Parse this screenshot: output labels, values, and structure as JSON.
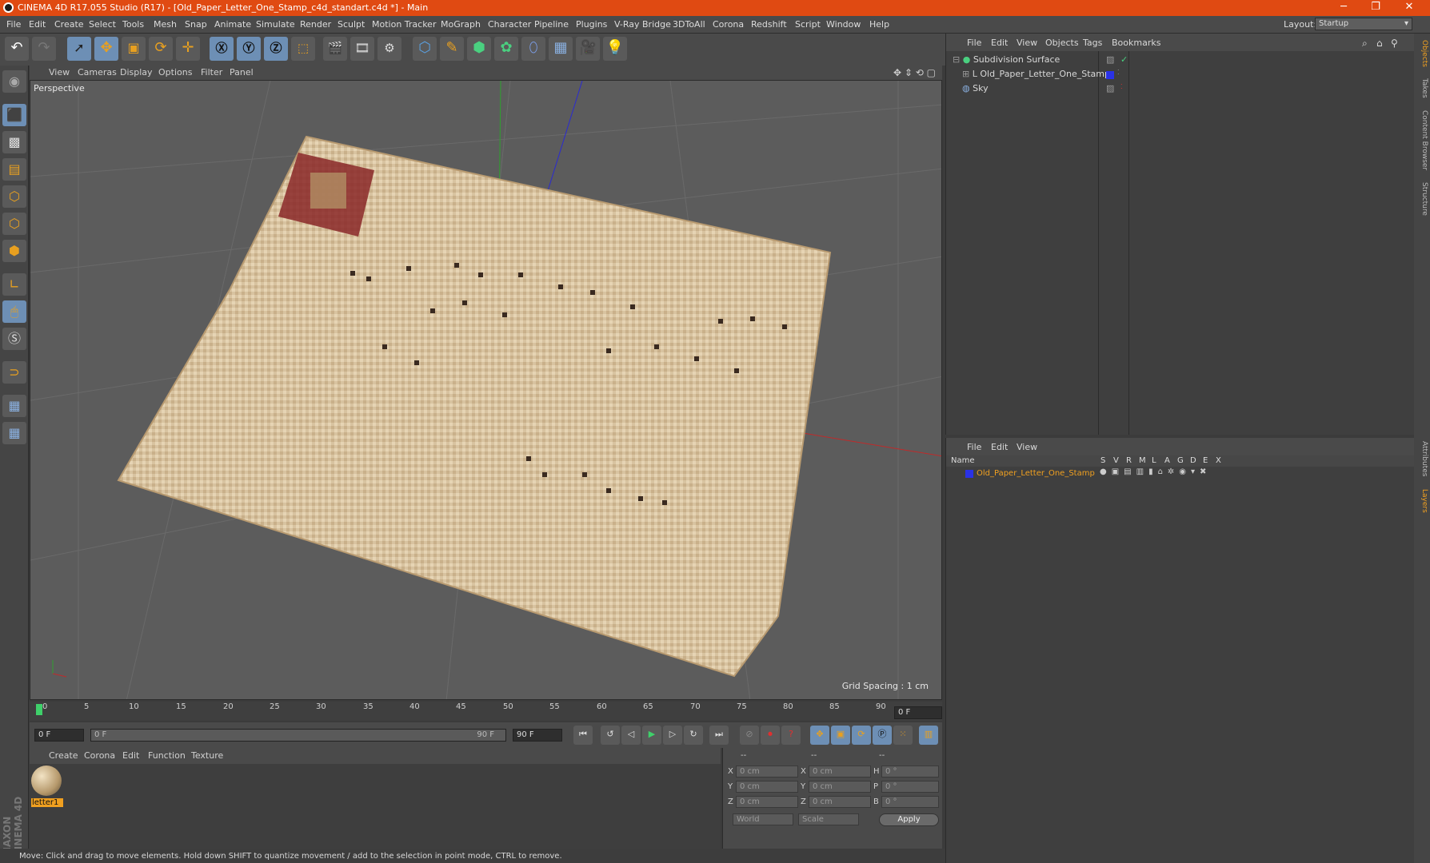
{
  "window": {
    "title": "CINEMA 4D R17.055 Studio (R17) - [Old_Paper_Letter_One_Stamp_c4d_standart.c4d *] - Main",
    "min": "─",
    "max": "❐",
    "close": "✕"
  },
  "menubar": [
    "File",
    "Edit",
    "Create",
    "Select",
    "Tools",
    "Mesh",
    "Snap",
    "Animate",
    "Simulate",
    "Render",
    "Sculpt",
    "Motion Tracker",
    "MoGraph",
    "Character",
    "Pipeline",
    "Plugins",
    "V-Ray Bridge",
    "3DToAll",
    "Corona",
    "Redshift",
    "Script",
    "Window",
    "Help"
  ],
  "layout": {
    "label": "Layout:",
    "value": "Startup"
  },
  "viewport": {
    "menu": [
      "View",
      "Cameras",
      "Display",
      "Options",
      "Filter",
      "Panel"
    ],
    "label": "Perspective",
    "grid_spacing": "Grid Spacing : 1 cm"
  },
  "timeline": {
    "ticks": [
      "0",
      "5",
      "10",
      "15",
      "20",
      "25",
      "30",
      "35",
      "40",
      "45",
      "50",
      "55",
      "60",
      "65",
      "70",
      "75",
      "80",
      "85",
      "90"
    ],
    "current_frame": "0 F"
  },
  "transport": {
    "start": "0 F",
    "range_start": "0 F",
    "range_end": "90 F",
    "end": "90 F"
  },
  "materials": {
    "menu": [
      "Create",
      "Corona",
      "Edit",
      "Function",
      "Texture"
    ],
    "items": [
      {
        "name": "letter1"
      }
    ]
  },
  "coordinates": {
    "header": [
      "--",
      "--",
      "--"
    ],
    "rows": [
      {
        "a": "X",
        "v1": "0 cm",
        "b": "X",
        "v2": "0 cm",
        "c": "H",
        "v3": "0 °"
      },
      {
        "a": "Y",
        "v1": "0 cm",
        "b": "Y",
        "v2": "0 cm",
        "c": "P",
        "v3": "0 °"
      },
      {
        "a": "Z",
        "v1": "0 cm",
        "b": "Z",
        "v2": "0 cm",
        "c": "B",
        "v3": "0 °"
      }
    ],
    "mode": "World",
    "scale": "Scale",
    "apply": "Apply"
  },
  "objects": {
    "menu": [
      "File",
      "Edit",
      "View",
      "Objects",
      "Tags",
      "Bookmarks"
    ],
    "items": [
      {
        "name": "Subdivision Surface"
      },
      {
        "name": "Old_Paper_Letter_One_Stamp"
      },
      {
        "name": "Sky"
      }
    ]
  },
  "layers": {
    "menu": [
      "File",
      "Edit",
      "View"
    ],
    "header": {
      "name": "Name",
      "cols": [
        "S",
        "V",
        "R",
        "M",
        "L",
        "A",
        "G",
        "D",
        "E",
        "X"
      ]
    },
    "items": [
      {
        "name": "Old_Paper_Letter_One_Stamp"
      }
    ]
  },
  "side_tabs": [
    "Objects",
    "Takes",
    "Content Browser",
    "Structure",
    "Attributes",
    "Layers"
  ],
  "status": "Move: Click and drag to move elements. Hold down SHIFT to quantize movement / add to the selection in point mode, CTRL to remove.",
  "brand": "MAXON CINEMA 4D",
  "colors": {
    "titlebar": "#e04a12",
    "accent": "#f0a020",
    "layer_blue": "#2a32e6"
  }
}
